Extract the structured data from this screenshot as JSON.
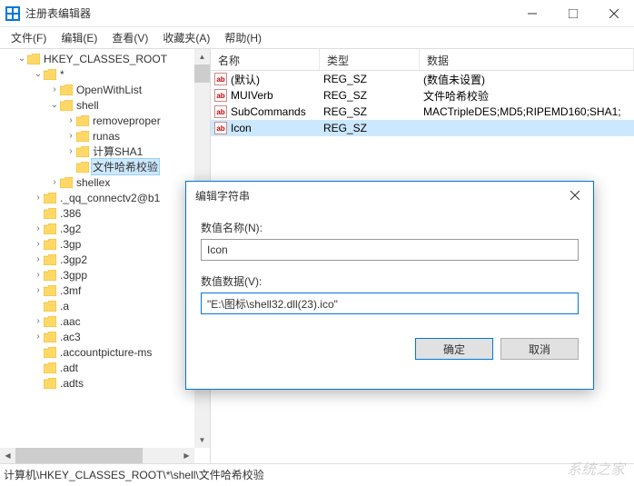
{
  "window": {
    "title": "注册表编辑器"
  },
  "menu": {
    "file": "文件(F)",
    "edit": "编辑(E)",
    "view": "查看(V)",
    "favorites": "收藏夹(A)",
    "help": "帮助(H)"
  },
  "tree": {
    "root": "HKEY_CLASSES_ROOT",
    "star": "*",
    "openwithlist": "OpenWithList",
    "shell": "shell",
    "removeproper": "removeproper",
    "runas": "runas",
    "calcsha1": "计算SHA1",
    "filehasher": "文件哈希校验",
    "shellex": "shellex",
    "qqconnect": "._qq_connectv2@b1",
    "ext_386": ".386",
    "ext_3g2": ".3g2",
    "ext_3gp": ".3gp",
    "ext_3gp2": ".3gp2",
    "ext_3gpp": ".3gpp",
    "ext_3mf": ".3mf",
    "ext_a": ".a",
    "ext_aac": ".aac",
    "ext_ac3": ".ac3",
    "ext_accountpicture": ".accountpicture-ms",
    "ext_adt": ".adt",
    "ext_adts": ".adts"
  },
  "list": {
    "headers": {
      "name": "名称",
      "type": "类型",
      "data": "数据"
    },
    "rows": [
      {
        "name": "(默认)",
        "type": "REG_SZ",
        "data": "(数值未设置)"
      },
      {
        "name": "MUIVerb",
        "type": "REG_SZ",
        "data": "文件哈希校验"
      },
      {
        "name": "SubCommands",
        "type": "REG_SZ",
        "data": "MACTripleDES;MD5;RIPEMD160;SHA1;"
      },
      {
        "name": "Icon",
        "type": "REG_SZ",
        "data": ""
      }
    ]
  },
  "dialog": {
    "title": "编辑字符串",
    "name_label": "数值名称(N):",
    "name_value": "Icon",
    "data_label": "数值数据(V):",
    "data_value": "\"E:\\图标\\shell32.dll(23).ico\"",
    "ok": "确定",
    "cancel": "取消"
  },
  "statusbar": {
    "path": "计算机\\HKEY_CLASSES_ROOT\\*\\shell\\文件哈希校验"
  },
  "watermark": "系统之家"
}
